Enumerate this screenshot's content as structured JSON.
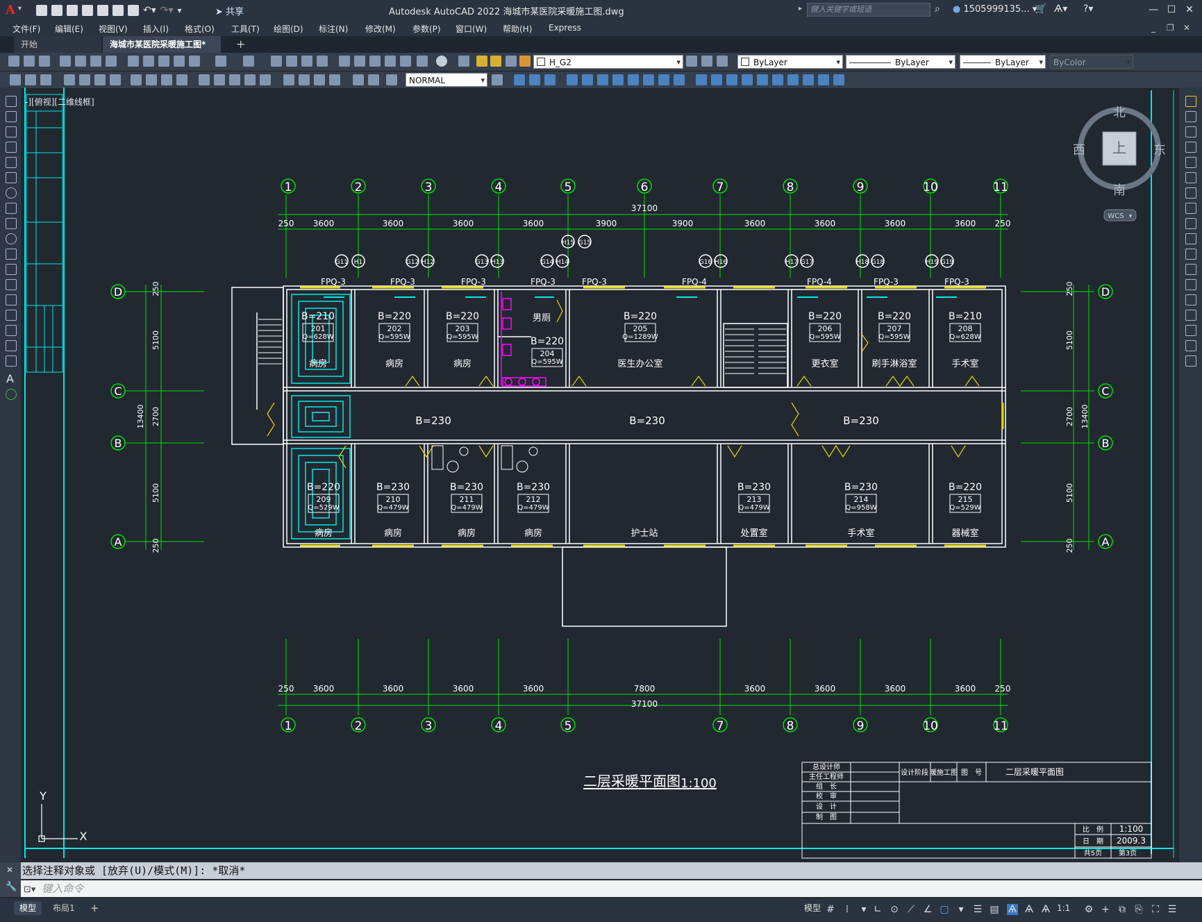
{
  "titlebar": {
    "app_title": "Autodesk AutoCAD 2022    海城市某医院采暖施工图.dwg",
    "share": "共享",
    "search_placeholder": "键入关键字或短语",
    "user": "1505999135..."
  },
  "menus": [
    "文件(F)",
    "编辑(E)",
    "视图(V)",
    "插入(I)",
    "格式(O)",
    "工具(T)",
    "绘图(D)",
    "标注(N)",
    "修改(M)",
    "参数(P)",
    "窗口(W)",
    "帮助(H)",
    "Express"
  ],
  "tabs": {
    "start": "开始",
    "doc": "海城市某医院采暖施工图*"
  },
  "toolbar": {
    "layer": "H_G2",
    "color": "ByLayer",
    "linetype": "ByLayer",
    "lineweight": "ByLayer",
    "plotstyle": "ByColor",
    "dimstyle": "NORMAL"
  },
  "viewport_label": "-][俯视][二维线框]",
  "viewcube": {
    "north": "北",
    "south": "南",
    "east": "东",
    "west": "西",
    "top": "上",
    "wcs": "WCS"
  },
  "drawing": {
    "grid_cols": [
      "1",
      "2",
      "3",
      "4",
      "5",
      "6",
      "7",
      "8",
      "9",
      "10",
      "11"
    ],
    "grid_cols_bottom": [
      "1",
      "2",
      "3",
      "4",
      "5",
      "7",
      "8",
      "9",
      "10",
      "11"
    ],
    "grid_rows": [
      "D",
      "C",
      "B",
      "A"
    ],
    "top_total": "37100",
    "top_dims": [
      "250",
      "3600",
      "3600",
      "3600",
      "3600",
      "3900",
      "3900",
      "3600",
      "3600",
      "3600",
      "3600",
      "250"
    ],
    "bottom_dims": [
      "250",
      "3600",
      "3600",
      "3600",
      "3600",
      "7800",
      "3600",
      "3600",
      "3600",
      "3600",
      "250"
    ],
    "bottom_total": "37100",
    "side_dims": [
      "250",
      "5100",
      "2700",
      "5100",
      "250"
    ],
    "side_total": "13400",
    "corridor_temp": "B=230",
    "rooms_top": [
      {
        "temp": "B=210",
        "no": "201",
        "q": "Q=628W",
        "name": "病房"
      },
      {
        "temp": "B=220",
        "no": "202",
        "q": "Q=595W",
        "name": "病房"
      },
      {
        "temp": "B=220",
        "no": "203",
        "q": "Q=595W",
        "name": "病房"
      },
      {
        "temp": "B=220",
        "no": "204",
        "q": "Q=595W",
        "name": "男厕"
      },
      {
        "temp": "B=220",
        "no": "205",
        "q": "Q=1289W",
        "name": "医生办公室"
      },
      {
        "temp": "B=220",
        "no": "206",
        "q": "Q=595W",
        "name": "更衣室"
      },
      {
        "temp": "B=220",
        "no": "207",
        "q": "Q=595W",
        "name": "刷手淋浴室"
      },
      {
        "temp": "B=210",
        "no": "208",
        "q": "Q=628W",
        "name": "手术室"
      }
    ],
    "rooms_bottom": [
      {
        "temp": "B=220",
        "no": "209",
        "q": "Q=529W",
        "name": "病房"
      },
      {
        "temp": "B=230",
        "no": "210",
        "q": "Q=479W",
        "name": "病房"
      },
      {
        "temp": "B=230",
        "no": "211",
        "q": "Q=479W",
        "name": "病房"
      },
      {
        "temp": "B=230",
        "no": "212",
        "q": "Q=479W",
        "name": "病房"
      },
      {
        "temp": "",
        "no": "",
        "q": "",
        "name": "护士站"
      },
      {
        "temp": "B=230",
        "no": "213",
        "q": "Q=479W",
        "name": "处置室"
      },
      {
        "temp": "B=230",
        "no": "214",
        "q": "Q=958W",
        "name": "手术室"
      },
      {
        "temp": "B=220",
        "no": "215",
        "q": "Q=529W",
        "name": "器械室"
      }
    ],
    "fpq": [
      "FPQ-3",
      "FPQ-3",
      "FPQ-3",
      "FPQ-3",
      "FPQ-3",
      "FPQ-4",
      "FPQ-4",
      "FPQ-3",
      "FPQ-3"
    ],
    "risers": [
      "G11",
      "H1",
      "G12",
      "H12",
      "G13",
      "H13",
      "G14",
      "H14",
      "H15",
      "G15",
      "G16",
      "H16",
      "H17",
      "G17",
      "H18",
      "G18",
      "H19",
      "G19"
    ],
    "plan_title": "二层采暖平面图",
    "plan_scale": "1:100",
    "titleblock": {
      "roles": [
        "总设计师",
        "主任工程师",
        "组　长",
        "校　审",
        "设　计",
        "制　图"
      ],
      "stage_label": "设计阶段",
      "stage": "暖施工图",
      "fig_label": "图　号",
      "fig_name": "二层采暖平面图",
      "scale_label": "比　例",
      "scale": "1:100",
      "date_label": "日　期",
      "date": "2009.3",
      "total": "共5页",
      "page": "第3页"
    },
    "ucs": {
      "x": "X",
      "y": "Y"
    }
  },
  "command": {
    "history": "选择注释对象或 [放弃(U)/模式(M)]: *取消*",
    "placeholder": "键入命令"
  },
  "status": {
    "model": "模型",
    "layout": "布局1",
    "model_btn": "模型",
    "scale": "1:1"
  },
  "colors": {
    "grid": "#00e000",
    "wall": "#ffffff",
    "radiator": "#e8d800",
    "floorheat": "#00e8e8",
    "fixture": "#ff00ff",
    "frame": "#00e8e8"
  }
}
